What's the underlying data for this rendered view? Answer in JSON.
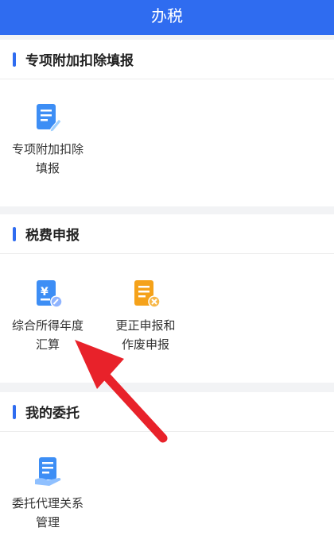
{
  "header": {
    "title": "办税"
  },
  "sections": [
    {
      "title": "专项附加扣除填报",
      "items": [
        {
          "label": "专项附加扣除\n填报",
          "icon": "edit-document-icon"
        }
      ]
    },
    {
      "title": "税费申报",
      "items": [
        {
          "label": "综合所得年度\n汇算",
          "icon": "yuan-document-icon"
        },
        {
          "label": "更正申报和\n作废申报",
          "icon": "cancel-document-icon"
        }
      ]
    },
    {
      "title": "我的委托",
      "items": [
        {
          "label": "委托代理关系\n管理",
          "icon": "hand-document-icon"
        }
      ]
    }
  ],
  "colors": {
    "accent": "#2f6cf0",
    "orange": "#f5a21a",
    "arrow": "#e8222a"
  }
}
